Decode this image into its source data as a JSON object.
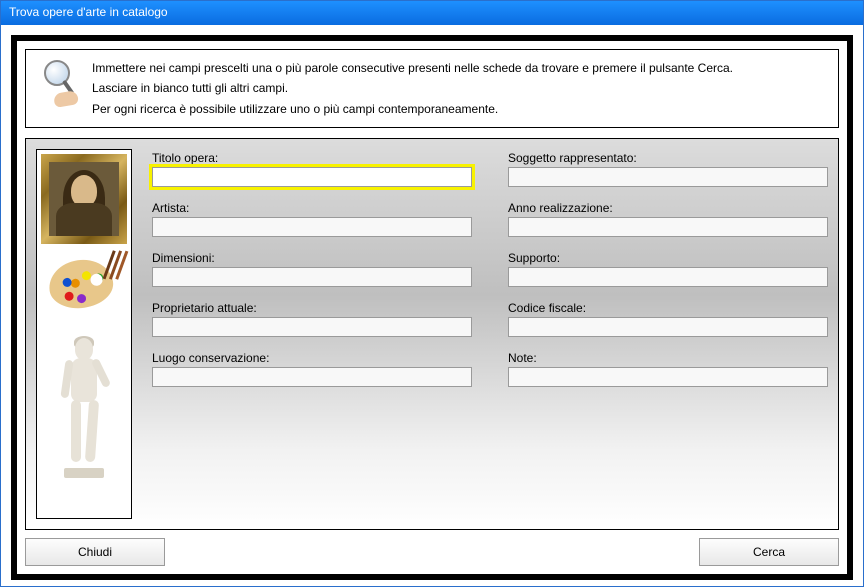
{
  "window": {
    "title": "Trova opere d'arte in catalogo"
  },
  "hint": {
    "line1": "Immettere nei campi prescelti una o più parole consecutive presenti nelle schede da trovare e premere il pulsante Cerca.",
    "line2": "Lasciare in bianco tutti gli altri campi.",
    "line3": "Per ogni ricerca è possibile utilizzare uno o più campi contemporaneamente."
  },
  "fields": {
    "titolo": {
      "label": "Titolo opera:",
      "value": ""
    },
    "soggetto": {
      "label": "Soggetto rappresentato:",
      "value": ""
    },
    "artista": {
      "label": "Artista:",
      "value": ""
    },
    "anno": {
      "label": "Anno realizzazione:",
      "value": ""
    },
    "dimensioni": {
      "label": "Dimensioni:",
      "value": ""
    },
    "supporto": {
      "label": "Supporto:",
      "value": ""
    },
    "proprietario": {
      "label": "Proprietario attuale:",
      "value": ""
    },
    "codfisc": {
      "label": "Codice fiscale:",
      "value": ""
    },
    "luogo": {
      "label": "Luogo conservazione:",
      "value": ""
    },
    "note": {
      "label": "Note:",
      "value": ""
    }
  },
  "buttons": {
    "close": "Chiudi",
    "search": "Cerca"
  },
  "icons": {
    "magnifier": "magnifier-icon",
    "mona": "mona-lisa-icon",
    "palette": "palette-icon",
    "david": "david-statue-icon"
  }
}
